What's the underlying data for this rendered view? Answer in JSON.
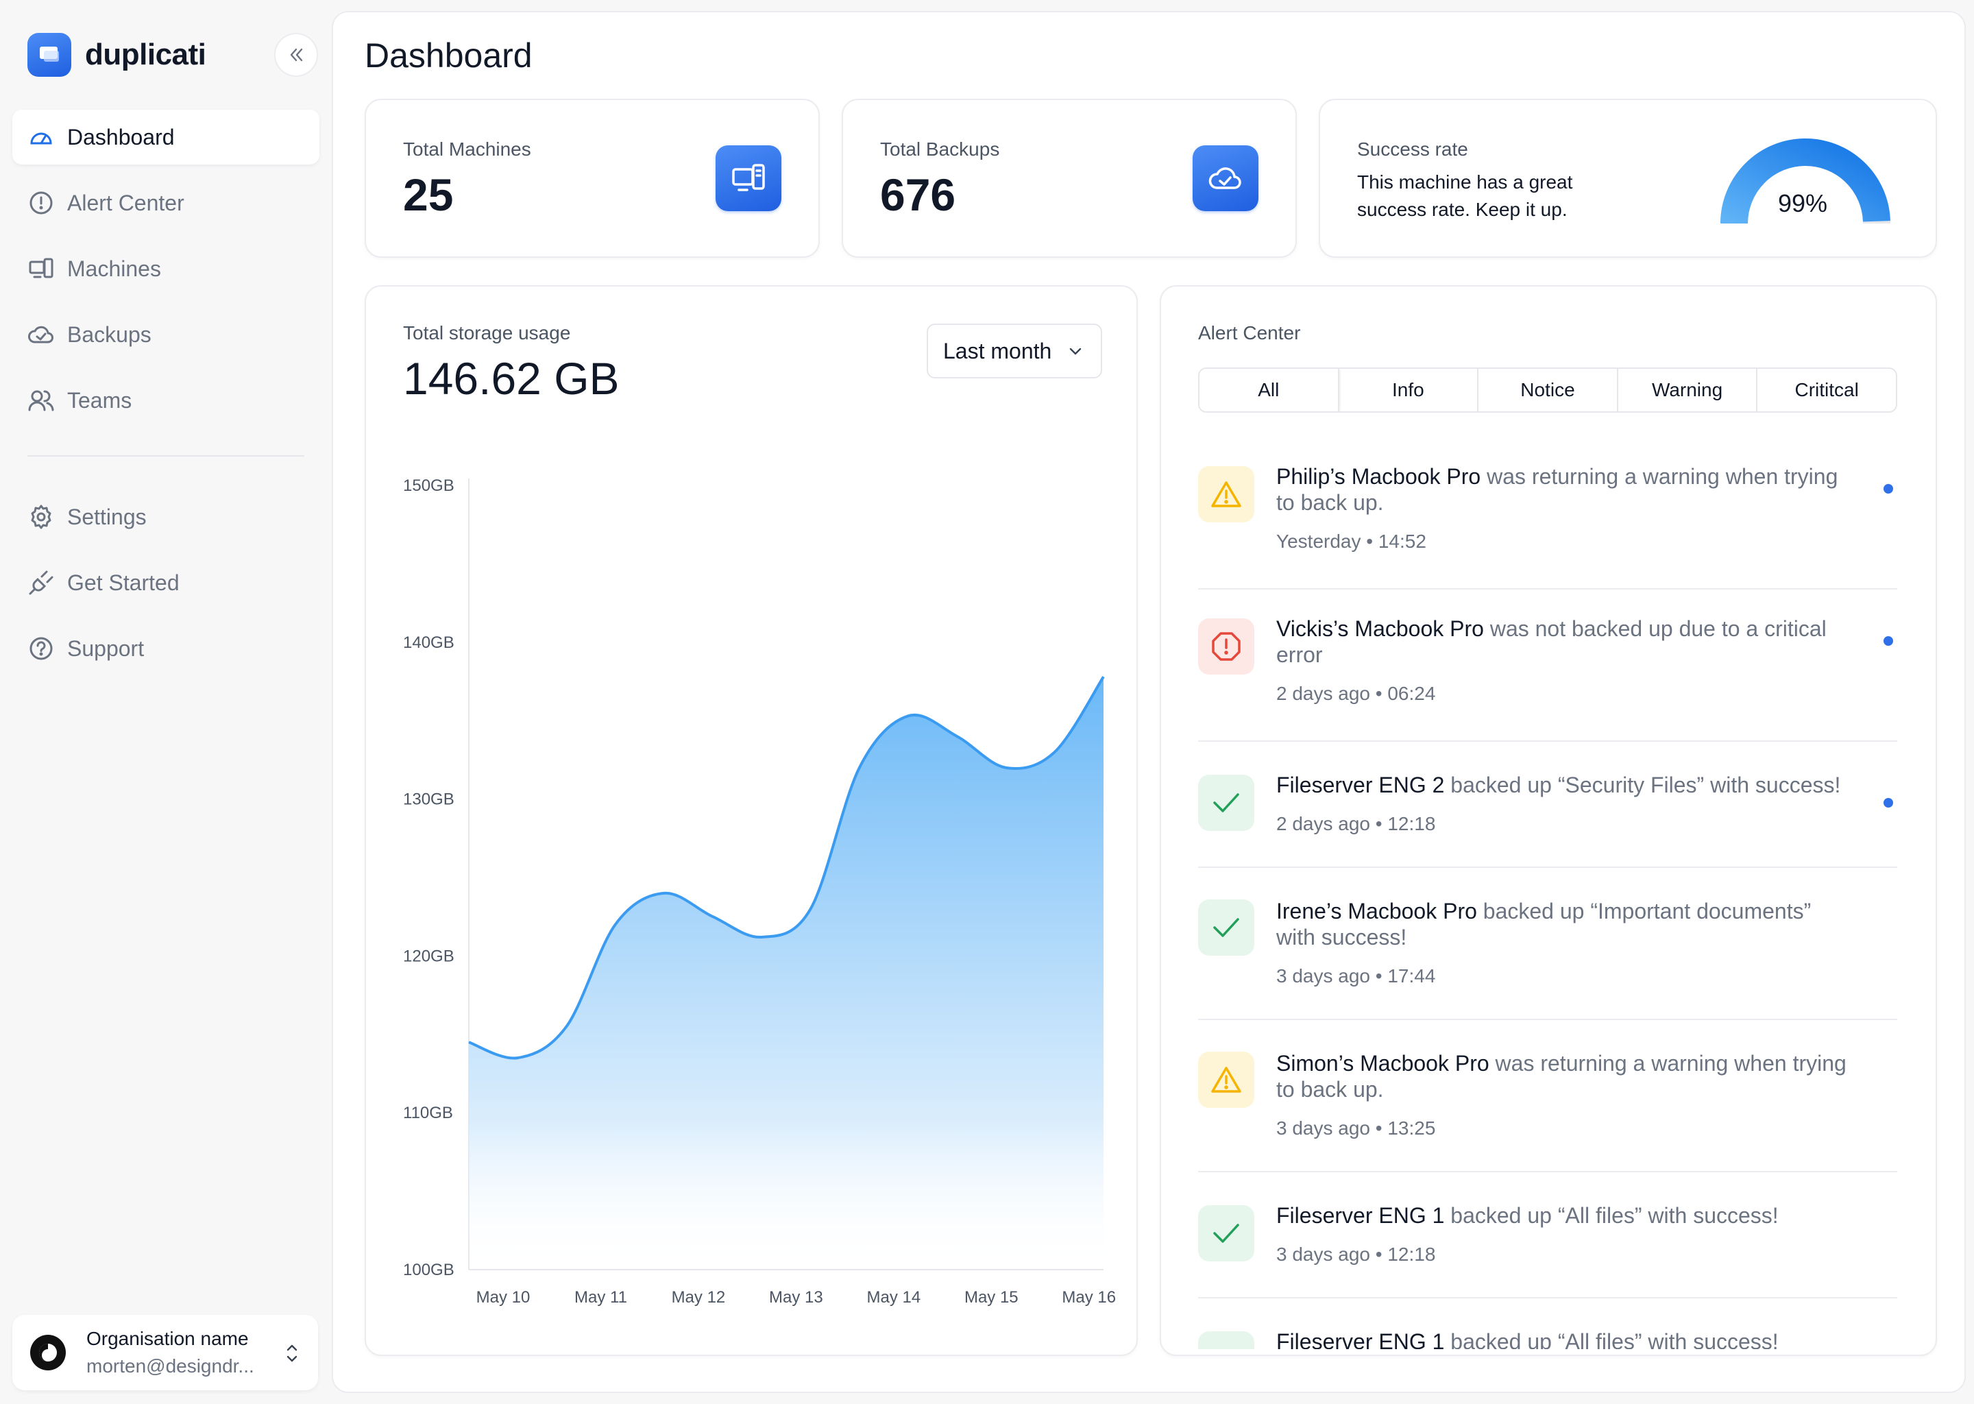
{
  "sidebar": {
    "brand": "duplicati",
    "items": [
      {
        "label": "Dashboard",
        "icon": "dashboard-gauge-icon",
        "active": true
      },
      {
        "label": "Alert Center",
        "icon": "alert-circle-icon"
      },
      {
        "label": "Machines",
        "icon": "machines-icon"
      },
      {
        "label": "Backups",
        "icon": "cloud-check-icon"
      },
      {
        "label": "Teams",
        "icon": "users-icon"
      }
    ],
    "secondary_items": [
      {
        "label": "Settings",
        "icon": "gear-icon"
      },
      {
        "label": "Get Started",
        "icon": "plug-icon"
      },
      {
        "label": "Support",
        "icon": "help-circle-icon"
      }
    ],
    "org": {
      "name": "Organisation name",
      "email": "morten@designdr..."
    }
  },
  "main": {
    "title": "Dashboard",
    "stats": {
      "machines": {
        "label": "Total Machines",
        "value": "25"
      },
      "backups": {
        "label": "Total Backups",
        "value": "676"
      },
      "success": {
        "label": "Success rate",
        "description": "This machine has a great success rate. Keep it up.",
        "value": "99%",
        "fraction": 0.99
      }
    },
    "storage": {
      "label": "Total storage usage",
      "value": "146.62 GB",
      "period": "Last month"
    },
    "alerts": {
      "title": "Alert Center",
      "tabs": [
        "All",
        "Info",
        "Notice",
        "Warning",
        "Crititcal"
      ],
      "items": [
        {
          "type": "warning",
          "actor": "Philip’s Macbook Pro",
          "message": " was returning a warning when trying to back up.",
          "time": "Yesterday • 14:52",
          "unread": true
        },
        {
          "type": "critical",
          "actor": "Vickis’s Macbook Pro",
          "message": " was not backed up due to a critical error",
          "time": "2 days ago  •  06:24",
          "unread": true
        },
        {
          "type": "success",
          "actor": "Fileserver ENG 2",
          "message": " backed up “Security Files” with success!",
          "time": "2 days ago  •  12:18",
          "unread": true
        },
        {
          "type": "success",
          "actor": "Irene’s Macbook Pro",
          "message": " backed up “Important documents” with success!",
          "time": "3 days ago  •  17:44",
          "unread": false
        },
        {
          "type": "warning",
          "actor": "Simon’s Macbook Pro",
          "message": " was returning a warning when trying to back up.",
          "time": "3 days ago  •  13:25",
          "unread": false
        },
        {
          "type": "success",
          "actor": "Fileserver ENG 1",
          "message": "  backed up “All files” with success!",
          "time": "3 days ago  •  12:18",
          "unread": false
        },
        {
          "type": "success",
          "actor": "Fileserver ENG 1",
          "message": "  backed up “All files” with success!",
          "time": "",
          "unread": false
        }
      ]
    }
  },
  "colors": {
    "accent": "#1f6fe8",
    "chart_line": "#3b9bf0",
    "warning": "#f4b400",
    "critical": "#e5483b",
    "success": "#22a05a"
  },
  "chart_data": {
    "type": "area",
    "x": [
      "May 10",
      "",
      "May 11",
      "",
      "May 12",
      "",
      "May 13",
      "",
      "May 14",
      "",
      "May 15",
      "",
      "May 16",
      ""
    ],
    "xtick_labels": [
      "May 10",
      "May 11",
      "May 12",
      "May 13",
      "May 14",
      "May 15",
      "May 16"
    ],
    "series": [
      {
        "values": [
          114.5,
          113.5,
          115.5,
          122,
          124,
          122.5,
          121.2,
          123,
          132,
          135.3,
          134,
          132,
          133,
          137.8
        ]
      }
    ],
    "ytick_labels": [
      "150GB",
      "140GB",
      "130GB",
      "120GB",
      "110GB",
      "100GB"
    ],
    "ylim": [
      100,
      150
    ]
  }
}
